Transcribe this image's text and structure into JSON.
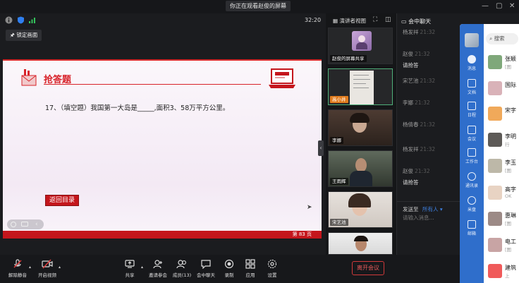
{
  "top_bar": {
    "sharing_banner": "你正在观看赵俊的屏幕",
    "time": "32:20",
    "lock_screen_label": "锁定画面"
  },
  "slide": {
    "heading": "抢答题",
    "question": "17、（填空题）我国第一大岛是_____,面积3、58万平方公里。",
    "back_button": "返回目录",
    "page_label": "第",
    "page_number": "83",
    "page_suffix": "页"
  },
  "video_panel": {
    "gallery_toggle": "演讲者视图",
    "tiles": [
      {
        "name": "赵俊的屏幕共享"
      },
      {
        "name": "高小井"
      },
      {
        "name": "李娜"
      },
      {
        "name": "王雨辉"
      },
      {
        "name": "宋艺池"
      },
      {
        "name": ""
      }
    ]
  },
  "chat": {
    "title": "会中聊天",
    "messages": [
      {
        "sender": "杨发祥",
        "time": "21:32",
        "text": ""
      },
      {
        "sender": "赵俊",
        "time": "21:32",
        "text": "请抢答"
      },
      {
        "sender": "宋艺池",
        "time": "21:32",
        "text": ""
      },
      {
        "sender": "李娜",
        "time": "21:32",
        "text": ""
      },
      {
        "sender": "杨倩春",
        "time": "21:32",
        "text": ""
      },
      {
        "sender": "杨发祥",
        "time": "21:32",
        "text": ""
      },
      {
        "sender": "赵俊",
        "time": "21:32",
        "text": "请抢答"
      }
    ],
    "send_to_label": "发送至",
    "send_to_value": "所有人",
    "input_placeholder": "请输入消息..."
  },
  "overlay_app": {
    "search_label": "搜索",
    "sidebar": [
      {
        "label": "消息"
      },
      {
        "label": "文档"
      },
      {
        "label": "日程"
      },
      {
        "label": "会议"
      },
      {
        "label": "工作台"
      },
      {
        "label": "通讯录"
      },
      {
        "label": "米盘"
      },
      {
        "label": "邮箱"
      }
    ],
    "conversations": [
      {
        "name": "张颖",
        "preview": "[图"
      },
      {
        "name": "国际",
        "preview": ""
      },
      {
        "name": "宋字",
        "preview": ""
      },
      {
        "name": "李明",
        "preview": "行"
      },
      {
        "name": "李玉",
        "preview": "[图"
      },
      {
        "name": "高字",
        "preview": "OK"
      },
      {
        "name": "惠琳",
        "preview": "[图"
      },
      {
        "name": "电工",
        "preview": "[图"
      },
      {
        "name": "建筑",
        "preview": "上"
      }
    ]
  },
  "toolbar": {
    "mute": "解除静音",
    "video": "开启视频",
    "share": "共享",
    "invite": "邀请参会",
    "members": "成员(13)",
    "chat": "会中聊天",
    "record": "录制",
    "apps": "应用",
    "settings": "设置",
    "leave": "离开会议"
  }
}
